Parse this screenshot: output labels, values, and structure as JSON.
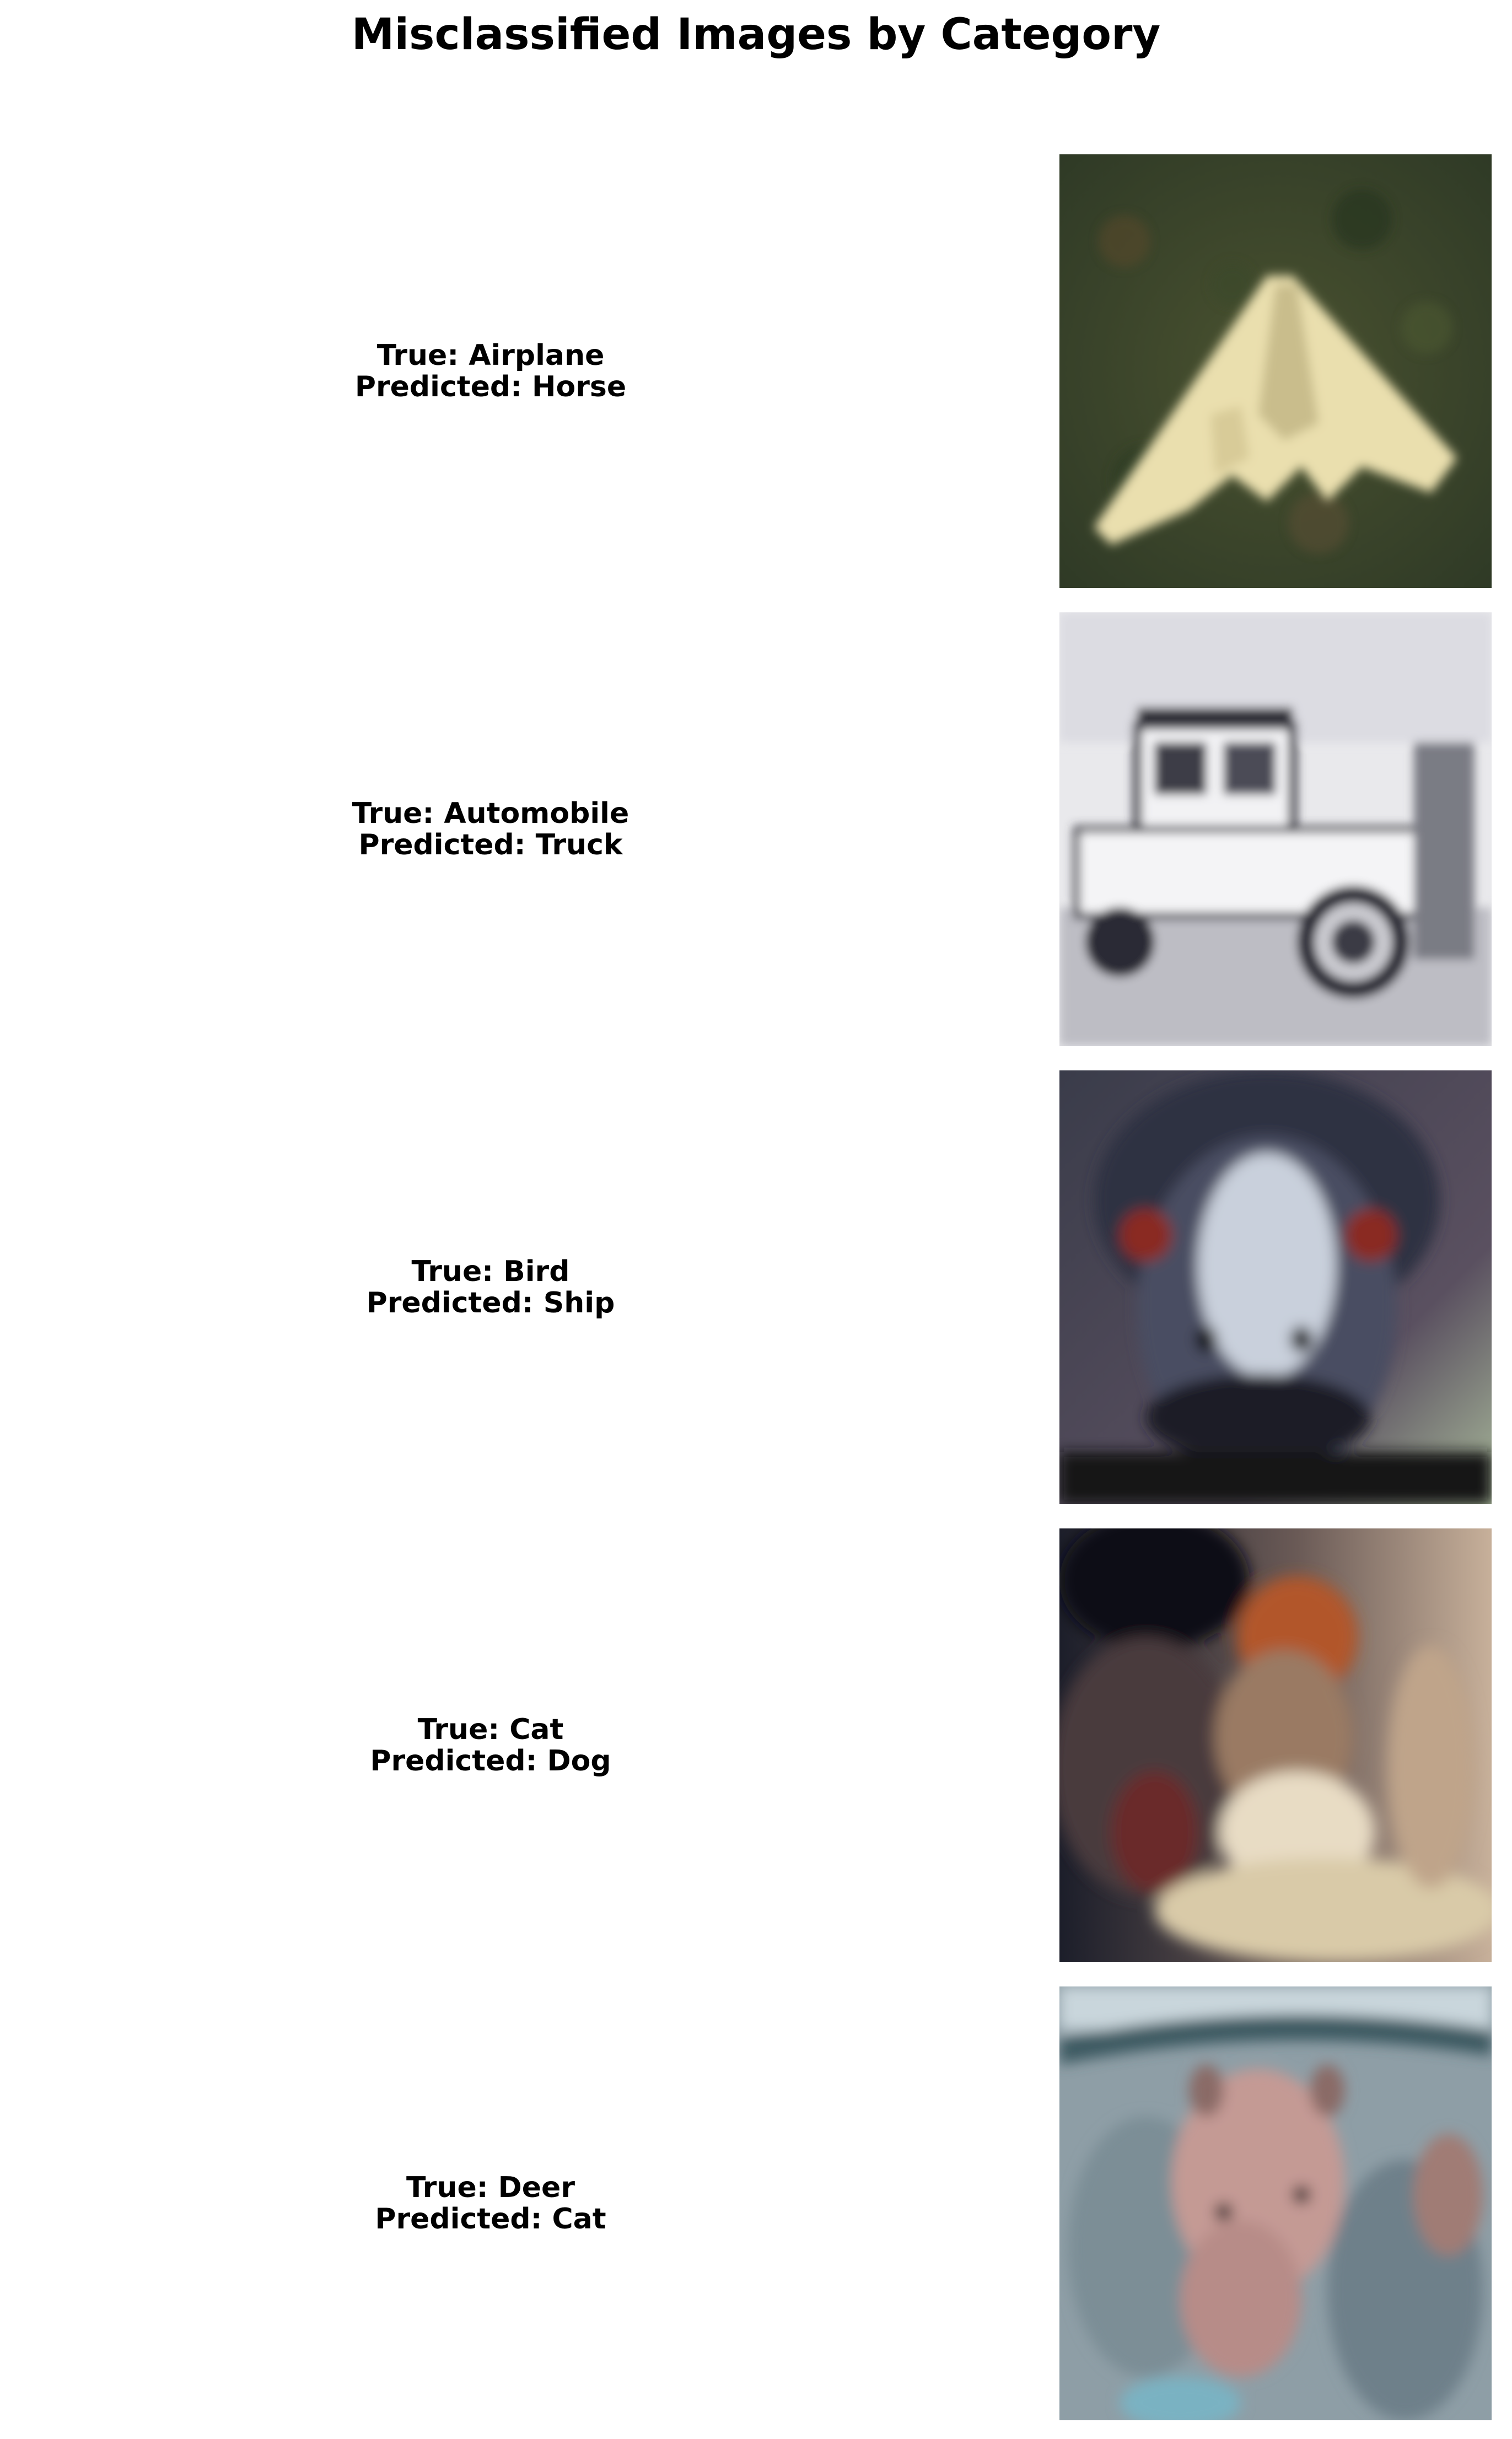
{
  "title": "Misclassified Images by Category",
  "samples": [
    {
      "true_label": "True: Airplane",
      "predicted_label": "Predicted: Horse"
    },
    {
      "true_label": "True: Automobile",
      "predicted_label": "Predicted: Truck"
    },
    {
      "true_label": "True: Bird",
      "predicted_label": "Predicted: Ship"
    },
    {
      "true_label": "True: Cat",
      "predicted_label": "Predicted: Dog"
    },
    {
      "true_label": "True: Deer",
      "predicted_label": "Predicted: Cat"
    }
  ]
}
